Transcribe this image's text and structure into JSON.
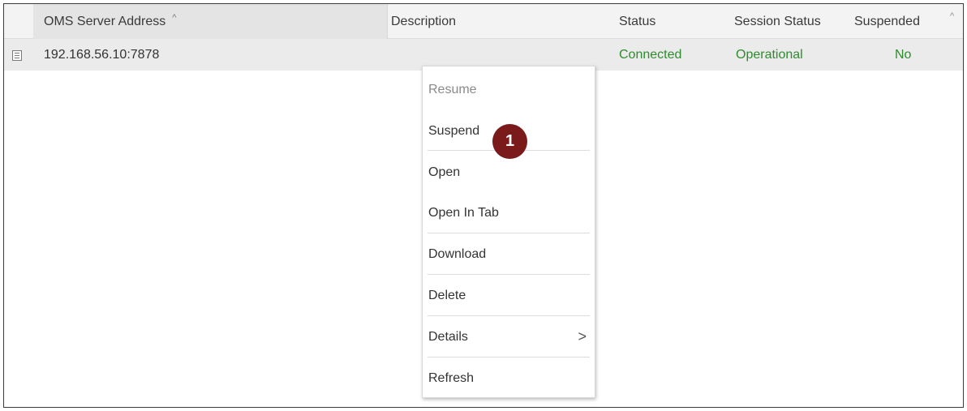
{
  "grid": {
    "columns": {
      "address": "OMS Server Address",
      "address_sort": "^",
      "description": "Description",
      "status": "Status",
      "session_status": "Session Status",
      "suspended": "Suspended",
      "corner_caret": "^"
    },
    "rows": [
      {
        "address": "192.168.56.10:7878",
        "description": "",
        "status": "Connected",
        "session_status": "Operational",
        "suspended": "No"
      }
    ]
  },
  "context_menu": {
    "items": [
      {
        "label": "Resume",
        "enabled": false
      },
      {
        "label": "Suspend",
        "enabled": true
      },
      {
        "label": "Open",
        "enabled": true
      },
      {
        "label": "Open In Tab",
        "enabled": true
      },
      {
        "label": "Download",
        "enabled": true
      },
      {
        "label": "Delete",
        "enabled": true
      },
      {
        "label": "Details",
        "enabled": true,
        "submenu_arrow": ">"
      },
      {
        "label": "Refresh",
        "enabled": true
      }
    ]
  },
  "callout": {
    "number": "1",
    "color": "#7a1a1a"
  },
  "colors": {
    "status_ok": "#2e8b2e"
  },
  "icons": {
    "row_icon": "list-detail-icon",
    "submenu": "chevron-right-icon",
    "sort": "sort-ascending-icon"
  }
}
